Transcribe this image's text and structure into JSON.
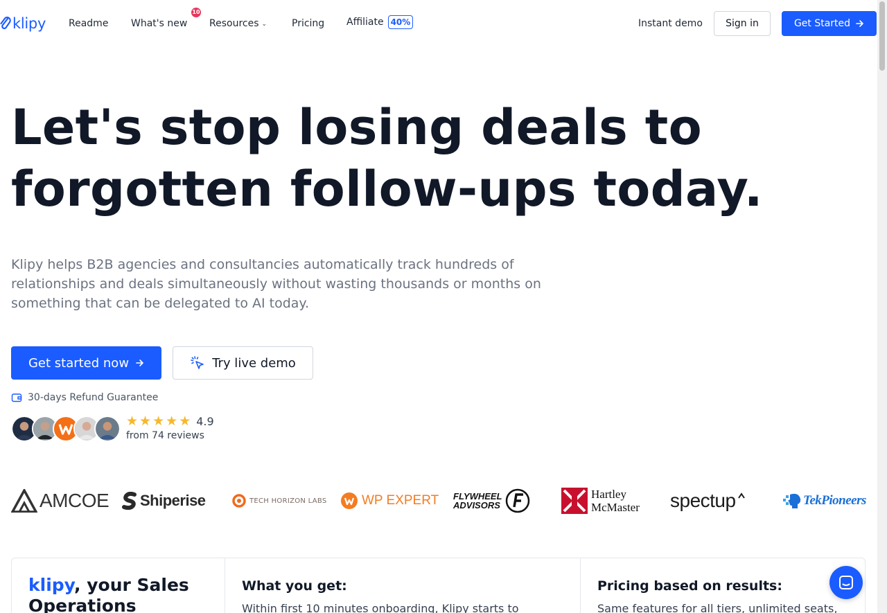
{
  "nav": {
    "logo_text": "klipy",
    "links": {
      "readme": "Readme",
      "whats_new": "What's new",
      "whats_new_badge": "10",
      "resources": "Resources",
      "pricing": "Pricing",
      "affiliate": "Affiliate",
      "affiliate_badge": "40%"
    },
    "instant_demo": "Instant demo",
    "sign_in": "Sign in",
    "get_started": "Get Started"
  },
  "hero": {
    "title": "Let's stop losing deals to forgotten follow-ups today.",
    "subtitle": "Klipy helps B2B agencies and consultancies automatically track hundreds of relationships and deals simultaneously without wasting thousands or months on something that can be delegated to AI today.",
    "primary_cta": "Get started now",
    "secondary_cta": "Try live demo",
    "refund_text": "30-days Refund Guarantee",
    "rating": {
      "stars": 5,
      "value": "4.9",
      "reviews_text": "from 74 reviews"
    }
  },
  "customer_logos": {
    "amcoe": "AMCOE",
    "shiperise": "Shiperise",
    "tech_horizon": "TECH HORIZON LABS",
    "wp_expert": "WP EXPERT",
    "flywheel_line1": "FLYWHEEL",
    "flywheel_line2": "ADVISORS",
    "hartley_line1": "Hartley",
    "hartley_line2": "McMaster",
    "spectup": "spectup",
    "tekpioneers": "TekPioneers"
  },
  "cards": {
    "brand": "klipy",
    "brand_suffix": ", your Sales Operations",
    "what_title": "What you get:",
    "what_body": "Within first 10 minutes onboarding, Klipy starts to",
    "pricing_title": "Pricing based on results:",
    "pricing_body": "Same features for all tiers, unlimited seats,"
  },
  "colors": {
    "brand_blue": "#1a5cff",
    "badge_red": "#e8365d",
    "star_yellow": "#f5b82e"
  },
  "icons": {
    "arrow": "arrow-right-icon",
    "cursor": "cursor-click-icon",
    "wallet": "wallet-icon",
    "chat": "chat-icon"
  }
}
